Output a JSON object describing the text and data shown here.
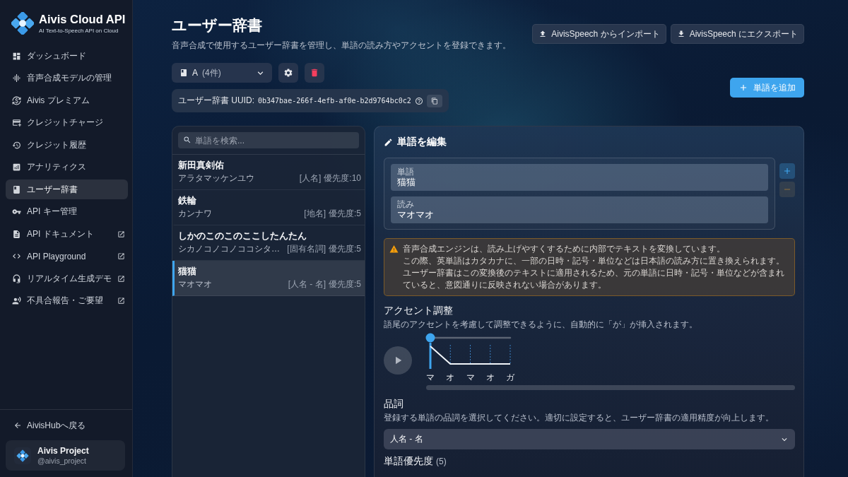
{
  "sidebar": {
    "logo": {
      "title": "Aivis Cloud API",
      "subtitle": "AI Text-to-Speech API on Cloud"
    },
    "items": [
      {
        "label": "ダッシュボード",
        "selected": false,
        "external": false
      },
      {
        "label": "音声合成モデルの管理",
        "selected": false,
        "external": false
      },
      {
        "label": "Aivis プレミアム",
        "selected": false,
        "external": false
      },
      {
        "label": "クレジットチャージ",
        "selected": false,
        "external": false
      },
      {
        "label": "クレジット履歴",
        "selected": false,
        "external": false
      },
      {
        "label": "アナリティクス",
        "selected": false,
        "external": false
      },
      {
        "label": "ユーザー辞書",
        "selected": true,
        "external": false
      },
      {
        "label": "API キー管理",
        "selected": false,
        "external": false
      },
      {
        "label": "API ドキュメント",
        "selected": false,
        "external": true
      },
      {
        "label": "API Playground",
        "selected": false,
        "external": true
      },
      {
        "label": "リアルタイム生成デモ",
        "selected": false,
        "external": true
      },
      {
        "label": "不具合報告・ご要望",
        "selected": false,
        "external": true
      }
    ],
    "back_link": "AivisHubへ戻る",
    "profile": {
      "name": "Aivis Project",
      "handle": "@aivis_project"
    }
  },
  "header": {
    "title": "ユーザー辞書",
    "subtitle": "音声合成で使用するユーザー辞書を管理し、単語の読み方やアクセントを登録できます。",
    "buttons": [
      "AivisSpeech からインポート",
      "AivisSpeech にエクスポート"
    ]
  },
  "dictionary": {
    "name": "A",
    "count": "(4件)",
    "uuid_label": "ユーザー辞書 UUID:",
    "uuid": "0b347bae-266f-4efb-af0e-b2d9764bc0c2"
  },
  "add_button": "単語を追加",
  "word_list": {
    "search_placeholder": "単語を検索...",
    "words": [
      {
        "surface": "新田真剣佑",
        "reading": "アラタマッケンユウ",
        "category": "[人名]",
        "priority": "優先度:10",
        "selected": false
      },
      {
        "surface": "鉄輪",
        "reading": "カンナワ",
        "category": "[地名]",
        "priority": "優先度:5",
        "selected": false
      },
      {
        "surface": "しかのこのこのここしたんたん",
        "reading": "シカノコノコノココシタ…",
        "category": "[固有名詞]",
        "priority": "優先度:5",
        "selected": false
      },
      {
        "surface": "猫猫",
        "reading": "マオマオ",
        "category": "[人名 - 名]",
        "priority": "優先度:5",
        "selected": true
      }
    ]
  },
  "editor": {
    "title": "単語を編集",
    "fields": [
      {
        "label": "単語",
        "value": "猫猫"
      },
      {
        "label": "読み",
        "value": "マオマオ"
      }
    ],
    "field_actions": [
      {
        "kind": "add",
        "disabled": false
      },
      {
        "kind": "remove",
        "disabled": true
      }
    ],
    "warning": [
      "音声合成エンジンは、読み上げやすくするために内部でテキストを変換しています。",
      "この際、英単語はカタカナに、一部の日時・記号・単位などは日本語の読み方に置き換えられます。",
      "ユーザー辞書はこの変換後のテキストに適用されるため、元の単語に日時・記号・単位などが含まれていると、意図通りに反映されない場合があります。"
    ],
    "accent": {
      "title": "アクセント調整",
      "description": "語尾のアクセントを考慮して調整できるように、自動的に「が」が挿入されます。",
      "level": 0,
      "morae": [
        "マ",
        "オ",
        "マ",
        "オ",
        "ガ"
      ]
    },
    "part_of_speech": {
      "title": "品詞",
      "description": "登録する単語の品詞を選択してください。適切に設定すると、ユーザー辞書の適用精度が向上します。",
      "value": "人名 - 名"
    },
    "priority": {
      "title": "単語優先度",
      "value": "(5)"
    }
  }
}
